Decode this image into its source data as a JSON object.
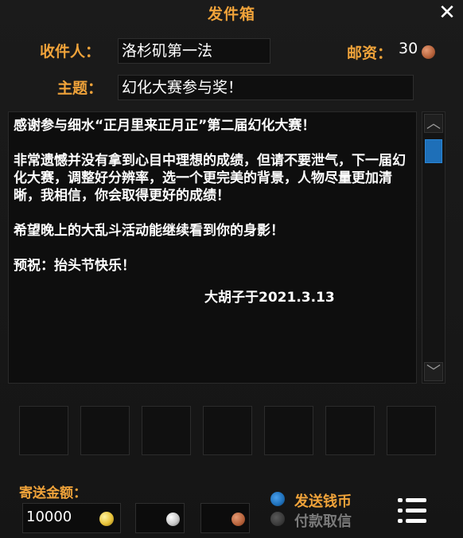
{
  "window": {
    "title": "发件箱"
  },
  "recipient": {
    "label": "收件人：",
    "value": "洛杉矶第一法"
  },
  "postage": {
    "label": "邮资：",
    "value": "30"
  },
  "subject": {
    "label": "主题：",
    "value": "幻化大赛参与奖！"
  },
  "message": {
    "paragraphs": [
      "感谢参与细水“正月里来正月正”第二届幻化大赛！",
      "非常遗憾并没有拿到心目中理想的成绩，但请不要泄气，下一届幻化大赛，调整好分辨率，选一个更完美的背景，人物尽量更加清晰，我相信，你会取得更好的成绩！",
      "希望晚上的大乱斗活动能继续看到你的身影！",
      "预祝：抬头节快乐！"
    ],
    "signature": "大胡子于2021.3.13"
  },
  "money": {
    "label": "寄送金额：",
    "gold": "10000",
    "silver": "",
    "copper": ""
  },
  "options": {
    "send_coins": "发送钱币",
    "cod": "付款取信",
    "selected": "send_coins"
  },
  "colors": {
    "accent": "#f0a33a",
    "selected_radio": "#1e6fb8",
    "gold": "#e8c33a",
    "silver": "#c9c9c9",
    "copper": "#b5613a"
  },
  "icons": [
    "close-icon",
    "copper-coin-icon",
    "scroll-up-icon",
    "scroll-down-icon",
    "gold-coin-icon",
    "silver-coin-icon",
    "menu-icon"
  ]
}
